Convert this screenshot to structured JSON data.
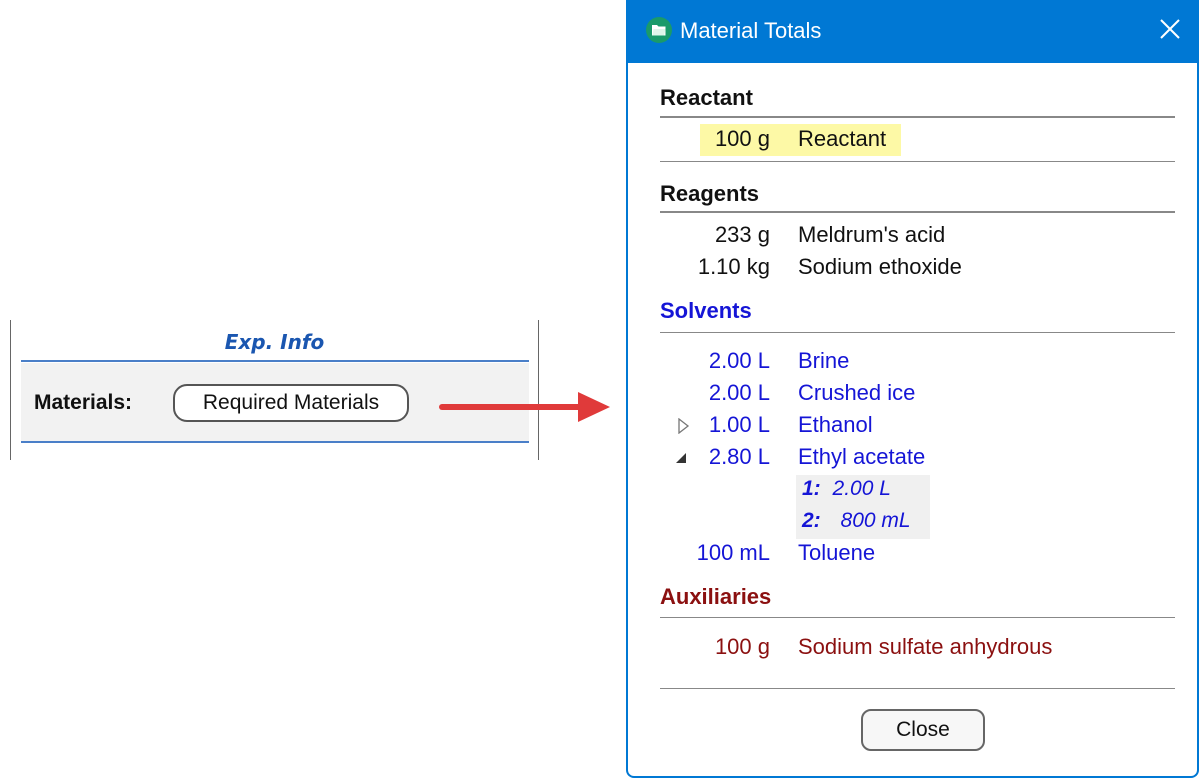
{
  "exp_info": {
    "title": "Exp. Info",
    "materials_label": "Materials:",
    "required_materials_button": "Required Materials"
  },
  "dialog": {
    "title": "Material Totals",
    "close_button": "Close",
    "sections": {
      "reactant": {
        "heading": "Reactant",
        "items": [
          {
            "qty": "100 g",
            "name": "Reactant"
          }
        ]
      },
      "reagents": {
        "heading": "Reagents",
        "items": [
          {
            "qty": "233 g",
            "name": "Meldrum's acid"
          },
          {
            "qty": "1.10 kg",
            "name": "Sodium ethoxide"
          }
        ]
      },
      "solvents": {
        "heading": "Solvents",
        "items": [
          {
            "qty": "2.00 L",
            "name": "Brine"
          },
          {
            "qty": "2.00 L",
            "name": "Crushed ice"
          },
          {
            "qty": "1.00 L",
            "name": "Ethanol"
          },
          {
            "qty": "2.80 L",
            "name": "Ethyl acetate"
          },
          {
            "qty": "100 mL",
            "name": "Toluene"
          }
        ],
        "ethyl_acetate_breakdown": [
          {
            "index": "1:",
            "qty": "2.00 L"
          },
          {
            "index": "2:",
            "qty": "800 mL"
          }
        ]
      },
      "auxiliaries": {
        "heading": "Auxiliaries",
        "items": [
          {
            "qty": "100 g",
            "name": "Sodium sulfate anhydrous"
          }
        ]
      }
    }
  },
  "colors": {
    "accent": "#0078d4",
    "solvents": "#1515d6",
    "auxiliaries": "#8b1010",
    "highlight": "#fdf9a6",
    "arrow": "#e03a3a"
  }
}
